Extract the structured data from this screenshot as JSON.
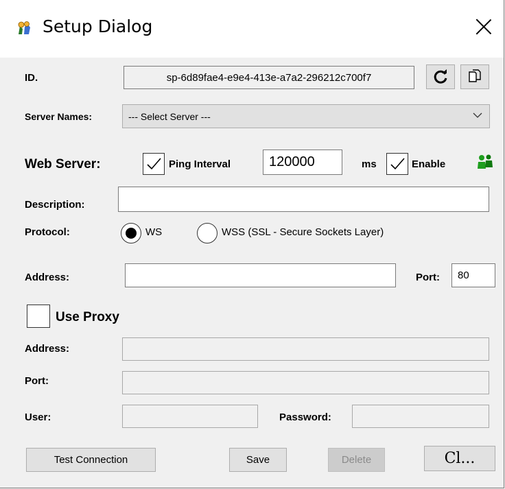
{
  "window": {
    "title": "Setup Dialog"
  },
  "id_row": {
    "label": "ID.",
    "value": "sp-6d89fae4-e9e4-413e-a7a2-296212c700f7"
  },
  "server_names": {
    "label": "Server Names:",
    "selected": "--- Select Server ---"
  },
  "web_server": {
    "label": "Web Server:",
    "ping_interval_label": "Ping Interval",
    "ping_interval_checked": true,
    "ping_interval_value": "120000",
    "unit": "ms",
    "enable_label": "Enable",
    "enable_checked": true
  },
  "description": {
    "label": "Description:",
    "value": ""
  },
  "protocol": {
    "label": "Protocol:",
    "options": [
      {
        "label": "WS",
        "selected": true
      },
      {
        "label": "WSS  (SSL - Secure Sockets Layer)",
        "selected": false
      }
    ]
  },
  "address": {
    "label": "Address:",
    "value": ""
  },
  "port": {
    "label": "Port:",
    "value": "80"
  },
  "proxy": {
    "label": "Use Proxy",
    "checked": false,
    "address_label": "Address:",
    "port_label": "Port:",
    "user_label": "User:",
    "password_label": "Password:"
  },
  "buttons": {
    "test_connection": "Test Connection",
    "save": "Save",
    "delete": "Delete",
    "close": "Cl..."
  }
}
